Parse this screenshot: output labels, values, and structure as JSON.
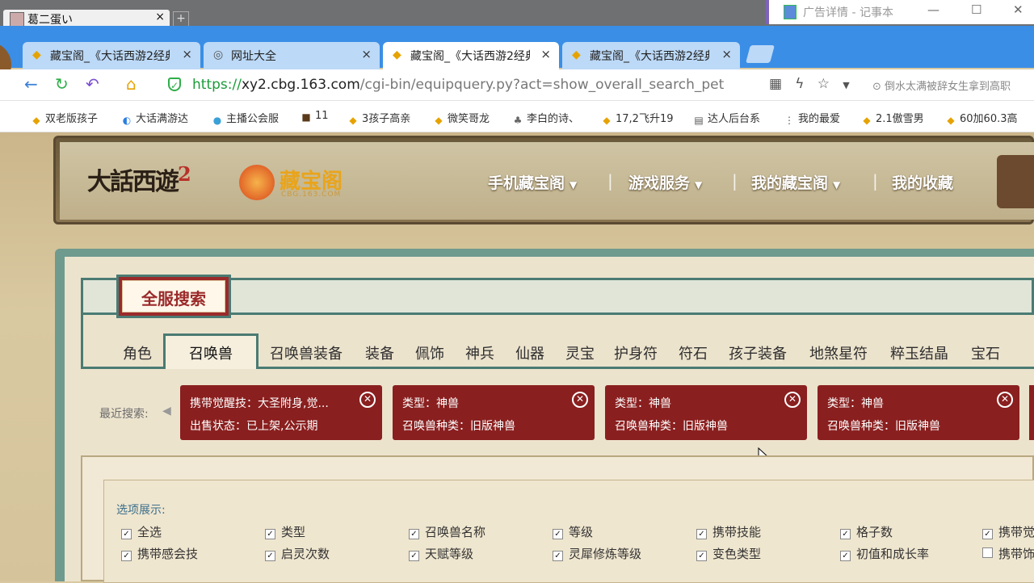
{
  "os": {
    "tab_title": "葛二蛋い",
    "close": "×",
    "plus": "+",
    "notepad_title": "广告详情 - 记事本",
    "min": "—",
    "max": "☐",
    "close2": "✕"
  },
  "tabs": [
    {
      "label": "藏宝阁_《大话西游2经典",
      "close": "×",
      "icon": "cbg-icon"
    },
    {
      "label": "网址大全",
      "close": "×",
      "icon": "globe-icon"
    },
    {
      "label": "藏宝阁_《大话西游2经典",
      "close": "×",
      "icon": "cbg-icon"
    },
    {
      "label": "藏宝阁_《大话西游2经典",
      "close": "×",
      "icon": "cbg-icon"
    }
  ],
  "address": {
    "https": "https://",
    "host": "xy2.cbg.163.com",
    "path": "/cgi-bin/equipquery.py?act=show_overall_search_pet",
    "news": "倒水太满被辞女生拿到高职"
  },
  "bookmarks": [
    "双老版孩子",
    "大话满游达",
    "主播公会服",
    "11",
    "3孩子高亲",
    "微笑哥龙",
    "李白的诗、",
    "17,2飞升19",
    "达人后台系",
    "我的最爱",
    "2.1傲雪男",
    "60加60.3高"
  ],
  "header": {
    "game_logo": "大話西遊",
    "game_logo_num": "2",
    "cbg_name": "藏宝阁",
    "cbg_sub": "CBG.163.COM",
    "nav": [
      "手机藏宝阁",
      "游戏服务",
      "我的藏宝阁",
      "我的收藏"
    ],
    "sep": "|",
    "caret": "▼"
  },
  "search": {
    "title": "全服搜索",
    "categories": [
      "角色",
      "召唤兽",
      "召唤兽装备",
      "装备",
      "佩饰",
      "神兵",
      "仙器",
      "灵宝",
      "护身符",
      "符石",
      "孩子装备",
      "地煞星符",
      "粹玉结晶",
      "宝石"
    ],
    "active_category": "召唤兽"
  },
  "recent": {
    "label": "最近搜索:",
    "chips": [
      {
        "line1": "携带觉醒技：大圣附身,觉...",
        "line2": "出售状态：已上架,公示期"
      },
      {
        "line1": "类型：神兽",
        "line2": "召唤兽种类：旧版神兽"
      },
      {
        "line1": "类型：神兽",
        "line2": "召唤兽种类：旧版神兽"
      },
      {
        "line1": "类型：神兽",
        "line2": "召唤兽种类：旧版神兽"
      }
    ]
  },
  "options": {
    "label": "选项展示:",
    "row1": [
      {
        "text": "全选",
        "checked": true
      },
      {
        "text": "类型",
        "checked": true
      },
      {
        "text": "召唤兽名称",
        "checked": true
      },
      {
        "text": "等级",
        "checked": true
      },
      {
        "text": "携带技能",
        "checked": true
      },
      {
        "text": "格子数",
        "checked": true
      },
      {
        "text": "携带觉",
        "checked": true
      }
    ],
    "row2": [
      {
        "text": "携带感会技",
        "checked": true
      },
      {
        "text": "启灵次数",
        "checked": true
      },
      {
        "text": "天赋等级",
        "checked": true
      },
      {
        "text": "灵犀修炼等级",
        "checked": true
      },
      {
        "text": "变色类型",
        "checked": true
      },
      {
        "text": "初值和成长率",
        "checked": true
      },
      {
        "text": "携带饰",
        "checked": false
      }
    ]
  },
  "colors": {
    "tabbar": "#3a8ee6",
    "chip": "#8a1f1f",
    "teal": "#4a7b73"
  }
}
